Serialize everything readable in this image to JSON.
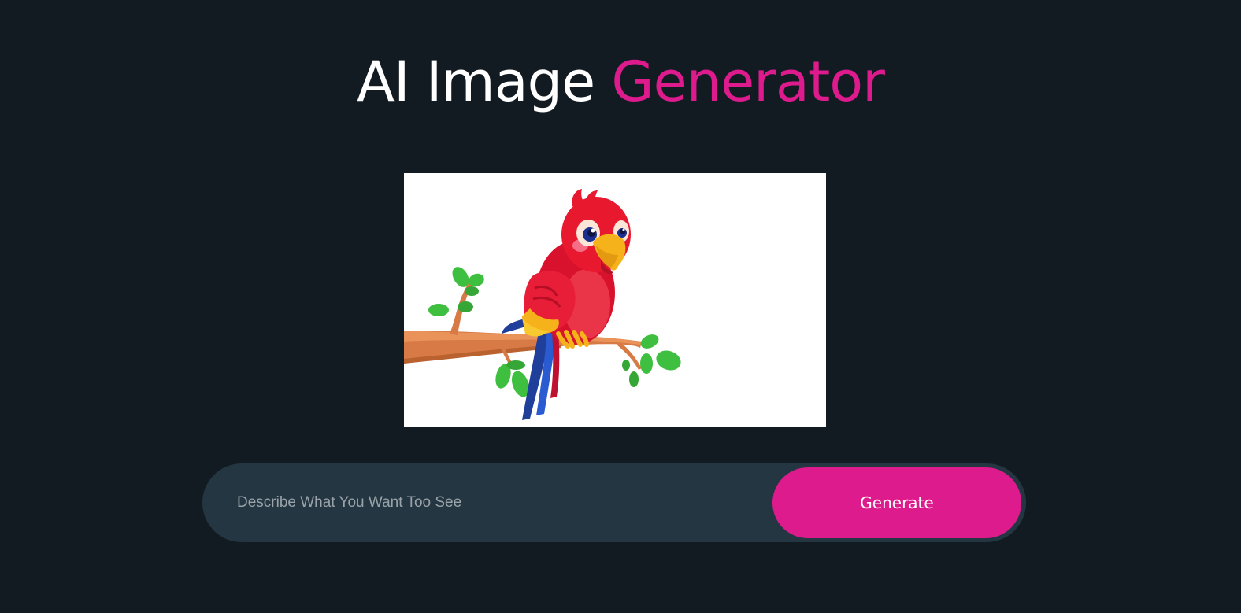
{
  "header": {
    "title_main": "AI Image",
    "title_accent": "Generator"
  },
  "preview": {
    "image_description": "parrot-on-branch-illustration"
  },
  "prompt": {
    "placeholder": "Describe What You Want Too See",
    "value": ""
  },
  "actions": {
    "generate_label": "Generate"
  },
  "colors": {
    "background": "#121b22",
    "accent": "#dd1b8c",
    "input_bar": "#233641",
    "text": "#ffffff",
    "placeholder": "#9aa3a9"
  }
}
